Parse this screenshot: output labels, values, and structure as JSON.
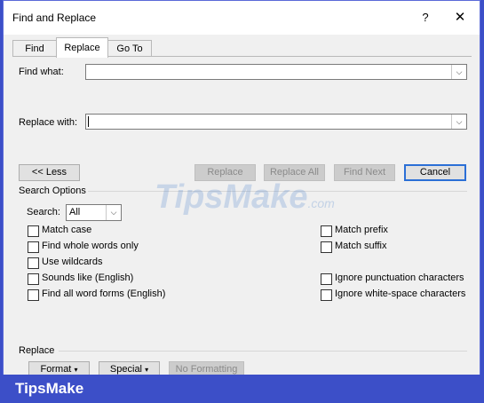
{
  "window": {
    "title": "Find and Replace",
    "help": "?",
    "close": "✕"
  },
  "tabs": [
    {
      "label": "Find"
    },
    {
      "label": "Replace"
    },
    {
      "label": "Go To"
    }
  ],
  "find": {
    "label": "Find what:",
    "value": ""
  },
  "replace": {
    "label": "Replace with:",
    "value": ""
  },
  "buttons": {
    "less": "<< Less",
    "replace": "Replace",
    "replace_all": "Replace All",
    "find_next": "Find Next",
    "cancel": "Cancel"
  },
  "search_options": {
    "heading": "Search Options",
    "search_label": "Search:",
    "search_value": "All"
  },
  "left_options": [
    {
      "label": "Match case",
      "checked": false
    },
    {
      "label": "Find whole words only",
      "checked": false
    },
    {
      "label": "Use wildcards",
      "checked": false
    },
    {
      "label": "Sounds like (English)",
      "checked": false
    },
    {
      "label": "Find all word forms (English)",
      "checked": false
    }
  ],
  "right_options": [
    {
      "label": "Match prefix",
      "checked": false
    },
    {
      "label": "Match suffix",
      "checked": false
    },
    {
      "label": "Ignore punctuation characters",
      "checked": false
    },
    {
      "label": "Ignore white-space characters",
      "checked": false
    }
  ],
  "replace_section": {
    "heading": "Replace",
    "format": "Format",
    "special": "Special",
    "no_formatting": "No Formatting",
    "dropdown_glyph": "▾"
  },
  "watermark": {
    "main": "TipsMake",
    "suffix": ".com"
  },
  "footer": {
    "brand": "TipsMake"
  },
  "icons": {
    "dropdown": "chevron-down-icon",
    "close": "close-icon",
    "help": "help-icon"
  }
}
